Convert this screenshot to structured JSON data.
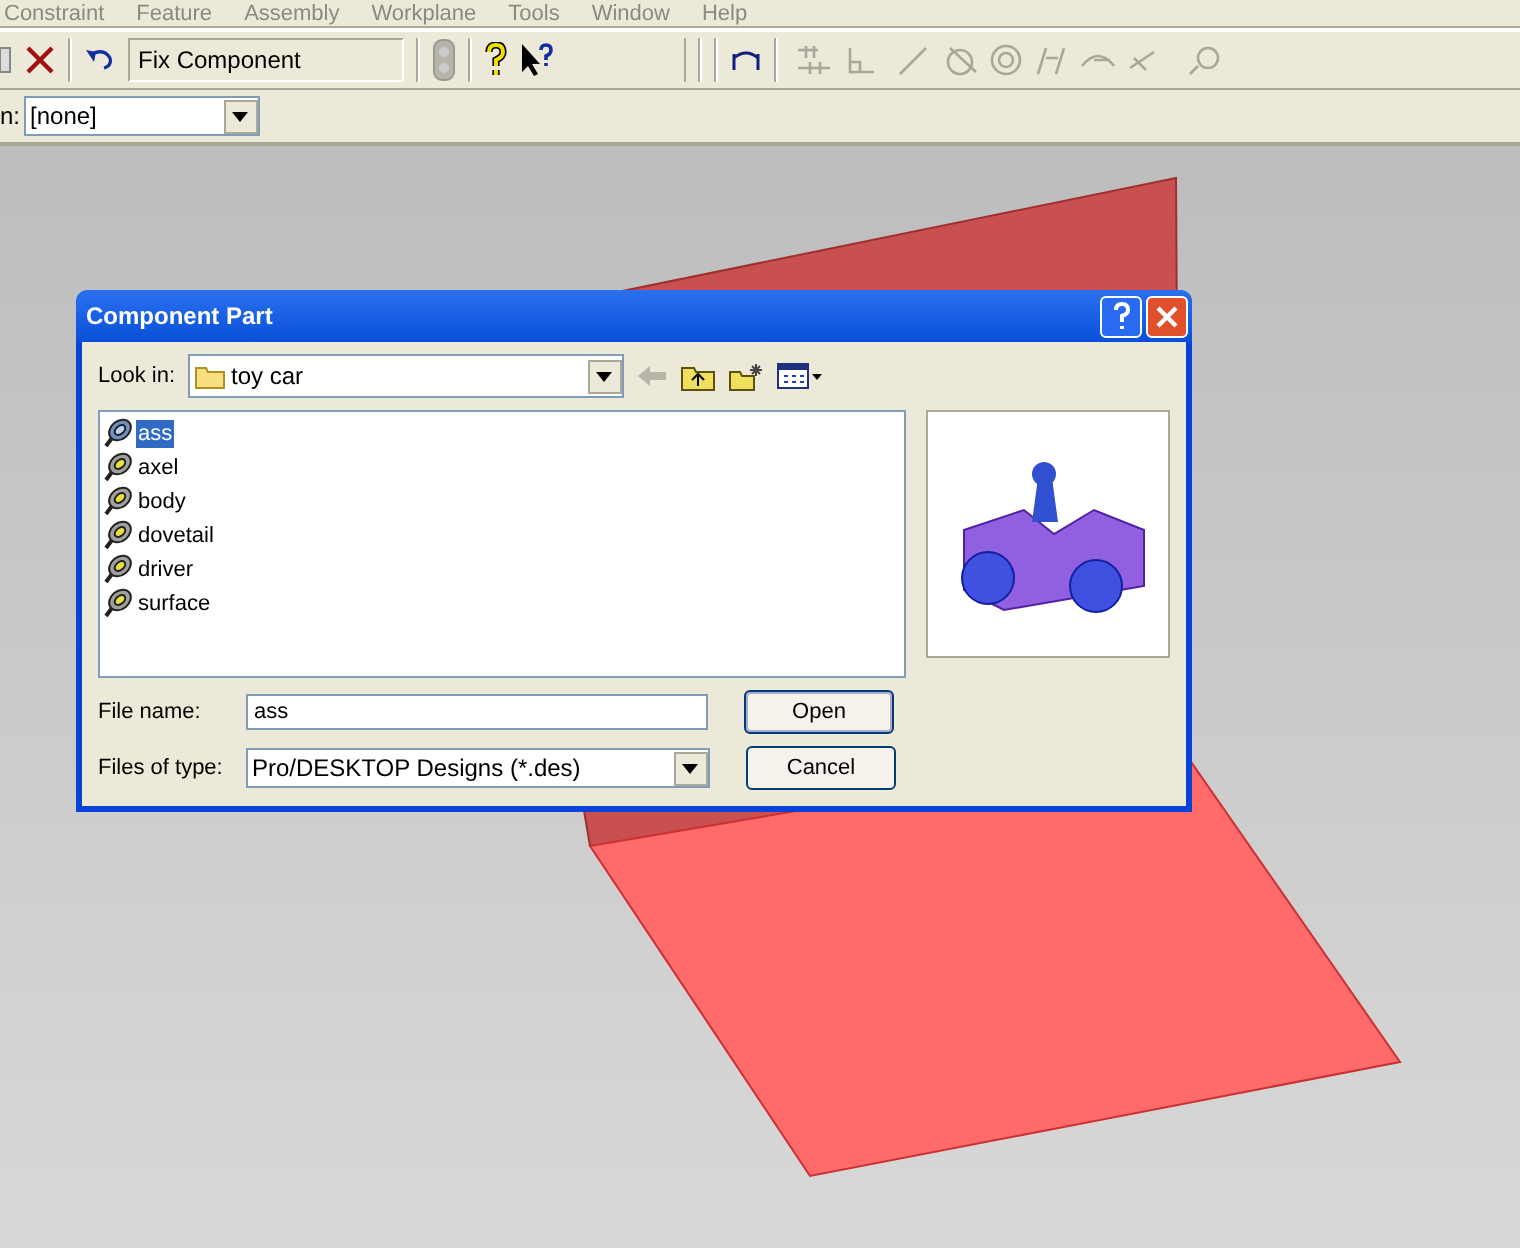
{
  "menu": [
    "Constraint",
    "Feature",
    "Assembly",
    "Workplane",
    "Tools",
    "Window",
    "Help"
  ],
  "toolbar": {
    "command": "Fix Component"
  },
  "toolbar2": {
    "label": "n:",
    "value": "[none]"
  },
  "dialog": {
    "title": "Component Part",
    "look_in_label": "Look in:",
    "look_in_value": "toy car",
    "files": [
      {
        "name": "ass",
        "selected": true
      },
      {
        "name": "axel",
        "selected": false
      },
      {
        "name": "body",
        "selected": false
      },
      {
        "name": "dovetail",
        "selected": false
      },
      {
        "name": "driver",
        "selected": false
      },
      {
        "name": "surface",
        "selected": false
      }
    ],
    "file_name_label": "File name:",
    "file_name_value": "ass",
    "file_type_label": "Files of type:",
    "file_type_value": "Pro/DESKTOP Designs (*.des)",
    "buttons": [
      "Open",
      "Cancel"
    ]
  }
}
